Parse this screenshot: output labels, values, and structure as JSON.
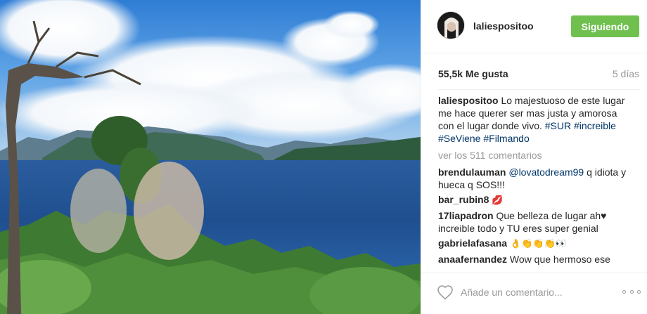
{
  "post": {
    "username": "laliespositoo",
    "follow_label": "Siguiendo",
    "likes": "55,5k Me gusta",
    "time_ago": "5 días",
    "caption": {
      "author": "laliespositoo",
      "text": " Lo majestuoso de este lugar me hace querer ser mas justa y amorosa con el lugar donde vivo. ",
      "hashtags": [
        "#SUR",
        "#increible",
        "#SeViene",
        "#Filmando"
      ]
    },
    "view_all_comments": "ver los 511 comentarios",
    "comments": [
      {
        "author": "brendulauman",
        "mention": "@lovatodream99",
        "text": " q idiota y hueca q SOS!!!",
        "emoji": ""
      },
      {
        "author": "bar_rubin8",
        "mention": "",
        "text": " ",
        "emoji": "💋"
      },
      {
        "author": "17liapadron",
        "mention": "",
        "text": " Que belleza de lugar ah♥ increible todo y TU eres super genial",
        "emoji": ""
      },
      {
        "author": "gabrielafasana",
        "mention": "",
        "text": " ",
        "emoji": "👌👏👏👏👀"
      },
      {
        "author": "anaafernandez",
        "mention": "",
        "text": " Wow que hermoso ese",
        "emoji": ""
      }
    ],
    "comment_placeholder": "Añade un comentario...",
    "icons": {
      "like": "heart-icon",
      "more": "more-options-icon"
    },
    "colors": {
      "follow_bg": "#70c050",
      "hashtag": "#003569",
      "muted": "#999999"
    }
  }
}
